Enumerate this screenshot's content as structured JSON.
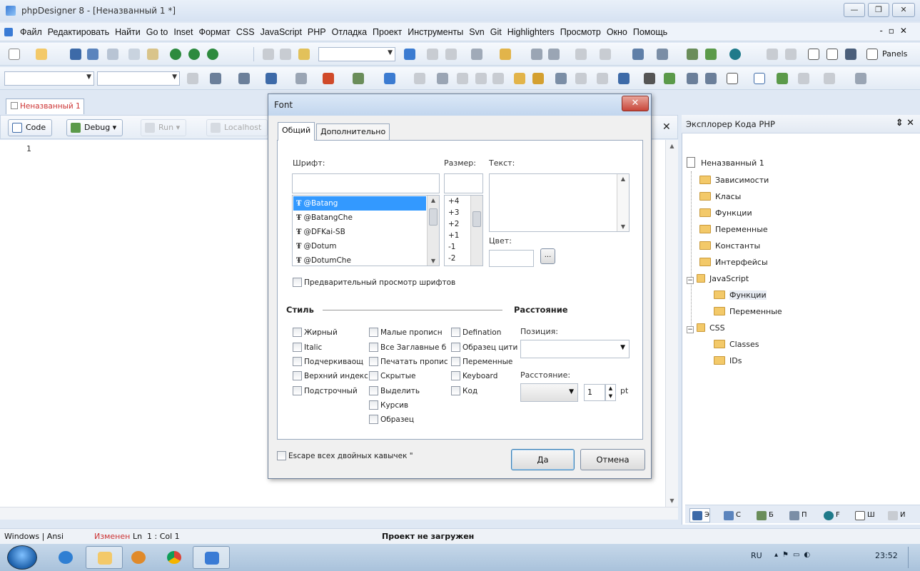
{
  "window": {
    "title": "phpDesigner 8 - [Неназванный 1 *]"
  },
  "menu": [
    "Файл",
    "Редактировать",
    "Найти",
    "Go to",
    "Inset",
    "Формат",
    "CSS",
    "JavaScript",
    "PHP",
    "Отладка",
    "Проект",
    "Инструменты",
    "Svn",
    "Git",
    "Highlighters",
    "Просмотр",
    "Окно",
    "Помощь"
  ],
  "toolbar": {
    "panels_label": "Panels"
  },
  "doc_tab": {
    "label": "Неназванный 1"
  },
  "editor_tools": {
    "code": "Code",
    "debug": "Debug",
    "run": "Run",
    "localhost": "Localhost"
  },
  "editor": {
    "line_numbers": [
      "1"
    ]
  },
  "explorer": {
    "title": "Эксплорер Кода PHP",
    "root": "Неназванный 1",
    "php_items": [
      "Зависимости",
      "Класы",
      "Функции",
      "Переменные",
      "Константы",
      "Интерфейсы"
    ],
    "js_label": "JavaScript",
    "js_items": [
      "Функции",
      "Переменные"
    ],
    "css_label": "CSS",
    "css_items": [
      "Classes",
      "IDs"
    ],
    "tabs": [
      "Э",
      "С",
      "Б",
      "П",
      "F",
      "Ш",
      "И"
    ]
  },
  "dialog": {
    "title": "Font",
    "tabs": [
      "Общий",
      "Дополнительно"
    ],
    "font_label": "Шрифт:",
    "size_label": "Размер:",
    "text_label": "Текст:",
    "color_label": "Цвет:",
    "color_button": "...",
    "fonts": [
      "@Batang",
      "@BatangChe",
      "@DFKai-SB",
      "@Dotum",
      "@DotumChe"
    ],
    "sizes": [
      "+4",
      "+3",
      "+2",
      "+1",
      "-1",
      "-2"
    ],
    "preview_label": "Предварительный просмотр шрифтов",
    "style_heading": "Стиль",
    "spacing_heading": "Расстояние",
    "style_col1": [
      "Жирный",
      "Italic",
      "Подчеркиваощ",
      "Верхний индекс",
      "Подстрочный"
    ],
    "style_col2": [
      "Малые прописн",
      "Все Заглавные б",
      "Печатать пропис",
      "Скрытые",
      "Выделить",
      "Курсив",
      "Образец"
    ],
    "style_col3": [
      "Defination",
      "Образец цити",
      "Переменные",
      "Keyboard",
      "Код"
    ],
    "position_label": "Позиция:",
    "distance_label": "Расстояние:",
    "distance_value": "1",
    "distance_unit": "pt",
    "escape_label": "Escape всех двойных кавычек \"",
    "ok": "Да",
    "cancel": "Отмена"
  },
  "status": {
    "encoding": "Windows | Ansi",
    "modified": "Изменен",
    "pos_ln": "Ln",
    "position": "1 : Col  1",
    "project": "Проект не загружен"
  },
  "taskbar": {
    "lang": "RU",
    "time": "23:52"
  },
  "colors": {
    "accent": "#3399ff",
    "tab_text": "#cc3333"
  }
}
